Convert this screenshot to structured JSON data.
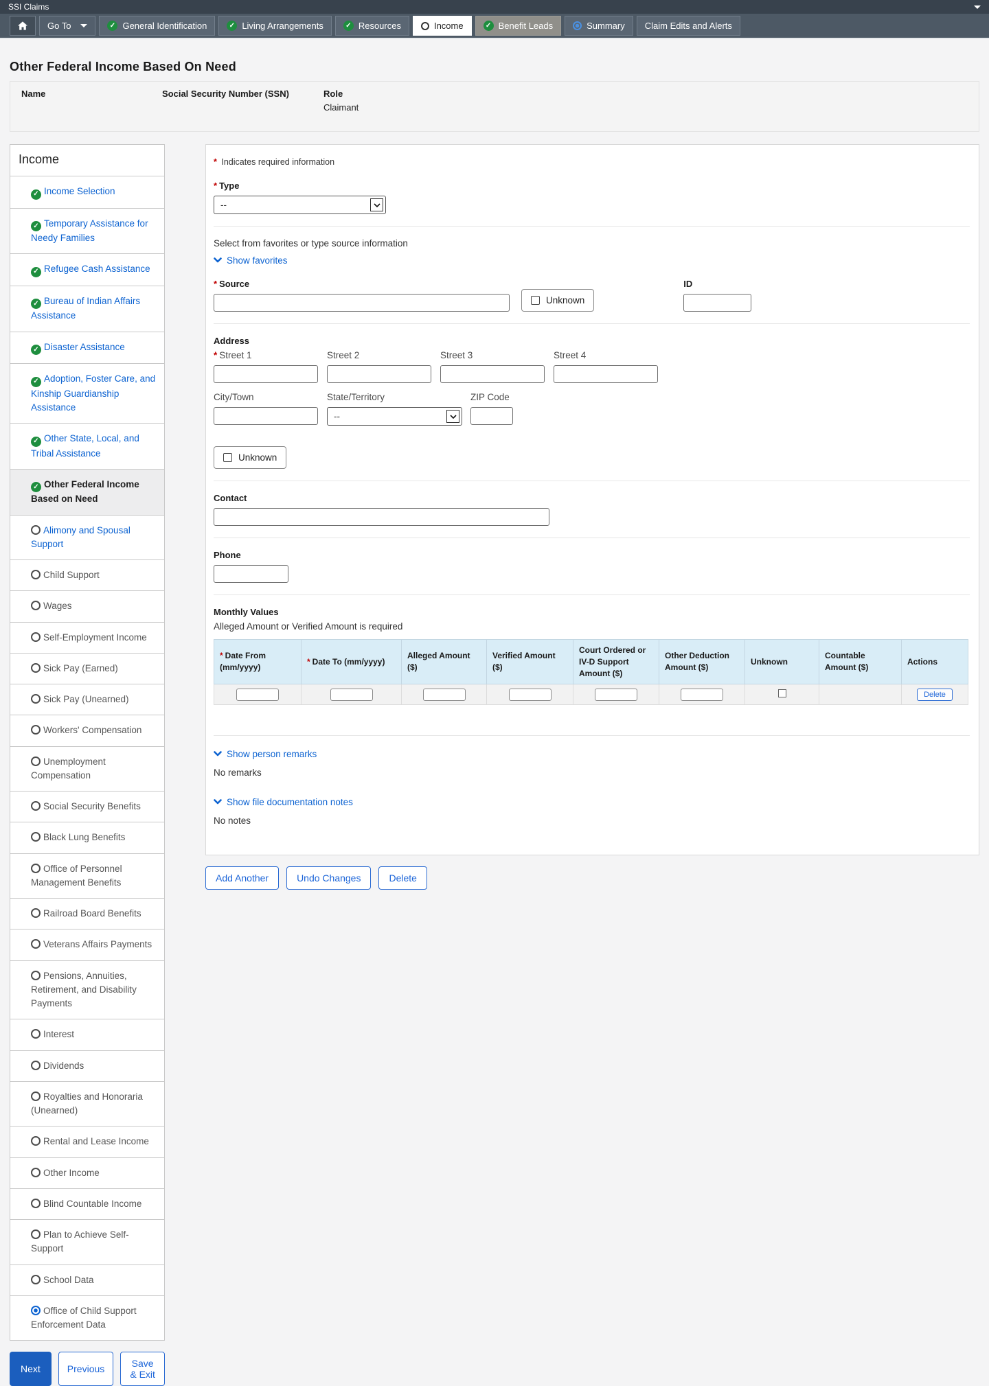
{
  "titlebar": {
    "app_title": "SSI Claims"
  },
  "navbar": {
    "go_to_label": "Go To",
    "tabs": [
      {
        "label": "General Identification",
        "icon": "check",
        "state": "normal"
      },
      {
        "label": "Living Arrangements",
        "icon": "check",
        "state": "normal"
      },
      {
        "label": "Resources",
        "icon": "check",
        "state": "normal"
      },
      {
        "label": "Income",
        "icon": "circle",
        "state": "active"
      },
      {
        "label": "Benefit Leads",
        "icon": "check",
        "state": "leads"
      },
      {
        "label": "Summary",
        "icon": "target",
        "state": "normal"
      },
      {
        "label": "Claim Edits and Alerts",
        "icon": "none",
        "state": "normal"
      }
    ]
  },
  "page": {
    "title": "Other Federal Income Based On Need"
  },
  "person": {
    "name_label": "Name",
    "name_value": "",
    "ssn_label": "Social Security Number (SSN)",
    "ssn_value": "",
    "role_label": "Role",
    "role_value": "Claimant"
  },
  "sidebar": {
    "title": "Income",
    "items": [
      {
        "label": "Income Selection",
        "icon": "check",
        "tone": "link"
      },
      {
        "label": "Temporary Assistance for Needy Families",
        "icon": "check",
        "tone": "link"
      },
      {
        "label": "Refugee Cash Assistance",
        "icon": "check",
        "tone": "link"
      },
      {
        "label": "Bureau of Indian Affairs Assistance",
        "icon": "check",
        "tone": "link"
      },
      {
        "label": "Disaster Assistance",
        "icon": "check",
        "tone": "link"
      },
      {
        "label": "Adoption, Foster Care, and Kinship Guardianship Assistance",
        "icon": "check",
        "tone": "link"
      },
      {
        "label": "Other State, Local, and Tribal Assistance",
        "icon": "check",
        "tone": "link"
      },
      {
        "label": "Other Federal Income Based on Need",
        "icon": "check",
        "tone": "active"
      },
      {
        "label": "Alimony and Spousal Support",
        "icon": "circle",
        "tone": "link"
      },
      {
        "label": "Child Support",
        "icon": "circle",
        "tone": "muted"
      },
      {
        "label": "Wages",
        "icon": "circle",
        "tone": "muted"
      },
      {
        "label": "Self-Employment Income",
        "icon": "circle",
        "tone": "muted"
      },
      {
        "label": "Sick Pay (Earned)",
        "icon": "circle",
        "tone": "muted"
      },
      {
        "label": "Sick Pay (Unearned)",
        "icon": "circle",
        "tone": "muted"
      },
      {
        "label": "Workers' Compensation",
        "icon": "circle",
        "tone": "muted"
      },
      {
        "label": "Unemployment Compensation",
        "icon": "circle",
        "tone": "muted"
      },
      {
        "label": "Social Security Benefits",
        "icon": "circle",
        "tone": "muted"
      },
      {
        "label": "Black Lung Benefits",
        "icon": "circle",
        "tone": "muted"
      },
      {
        "label": "Office of Personnel Management Benefits",
        "icon": "circle",
        "tone": "muted"
      },
      {
        "label": "Railroad Board Benefits",
        "icon": "circle",
        "tone": "muted"
      },
      {
        "label": "Veterans Affairs Payments",
        "icon": "circle",
        "tone": "muted"
      },
      {
        "label": "Pensions, Annuities, Retirement, and Disability Payments",
        "icon": "circle",
        "tone": "muted"
      },
      {
        "label": "Interest",
        "icon": "circle",
        "tone": "muted"
      },
      {
        "label": "Dividends",
        "icon": "circle",
        "tone": "muted"
      },
      {
        "label": "Royalties and Honoraria (Unearned)",
        "icon": "circle",
        "tone": "muted"
      },
      {
        "label": "Rental and Lease Income",
        "icon": "circle",
        "tone": "muted"
      },
      {
        "label": "Other Income",
        "icon": "circle",
        "tone": "muted"
      },
      {
        "label": "Blind Countable Income",
        "icon": "circle",
        "tone": "muted"
      },
      {
        "label": "Plan to Achieve Self-Support",
        "icon": "circle",
        "tone": "muted"
      },
      {
        "label": "School Data",
        "icon": "circle",
        "tone": "muted"
      },
      {
        "label": "Office of Child Support Enforcement Data",
        "icon": "radio",
        "tone": "muted"
      }
    ],
    "nav_buttons": {
      "next": "Next",
      "previous": "Previous",
      "save_exit": "Save & Exit"
    }
  },
  "form": {
    "required_note": "Indicates required information",
    "type": {
      "label": "Type",
      "value": "--"
    },
    "favorites": {
      "hint": "Select from favorites or type source information",
      "toggle": "Show favorites"
    },
    "source": {
      "label": "Source",
      "value": "",
      "unknown_label": "Unknown",
      "id_label": "ID",
      "id_value": ""
    },
    "address": {
      "heading": "Address",
      "street1_label": "Street 1",
      "street2_label": "Street 2",
      "street3_label": "Street 3",
      "street4_label": "Street 4",
      "city_label": "City/Town",
      "state_label": "State/Territory",
      "state_value": "--",
      "zip_label": "ZIP Code",
      "unknown_label": "Unknown"
    },
    "contact": {
      "label": "Contact",
      "value": ""
    },
    "phone": {
      "label": "Phone",
      "value": ""
    },
    "monthly": {
      "heading": "Monthly Values",
      "note": "Alleged Amount or Verified Amount is required",
      "columns": [
        {
          "label": "Date From (mm/yyyy)",
          "required": true
        },
        {
          "label": "Date To (mm/yyyy)",
          "required": true
        },
        {
          "label": "Alleged Amount ($)",
          "required": false
        },
        {
          "label": "Verified Amount ($)",
          "required": false
        },
        {
          "label": "Court Ordered or IV-D Support Amount ($)",
          "required": false
        },
        {
          "label": "Other Deduction Amount ($)",
          "required": false
        },
        {
          "label": "Unknown",
          "required": false
        },
        {
          "label": "Countable Amount ($)",
          "required": false
        },
        {
          "label": "Actions",
          "required": false
        }
      ],
      "row": {
        "delete_label": "Delete"
      }
    },
    "remarks": {
      "toggle": "Show person remarks",
      "empty": "No remarks"
    },
    "notes": {
      "toggle": "Show file documentation notes",
      "empty": "No notes"
    }
  },
  "actions": {
    "add_another": "Add Another",
    "undo_changes": "Undo Changes",
    "delete": "Delete"
  },
  "colors": {
    "titlebar_bg": "#38424d",
    "navbar_bg": "#4d5965",
    "active_tab_bg": "#ffffff",
    "leads_tab_bg": "#908f8a",
    "check_green": "#1e8e3e",
    "link_blue": "#0d63d1",
    "primary_button_blue": "#1b5ebe",
    "required_red": "#c00000",
    "table_header_bg": "#d9edf7"
  }
}
